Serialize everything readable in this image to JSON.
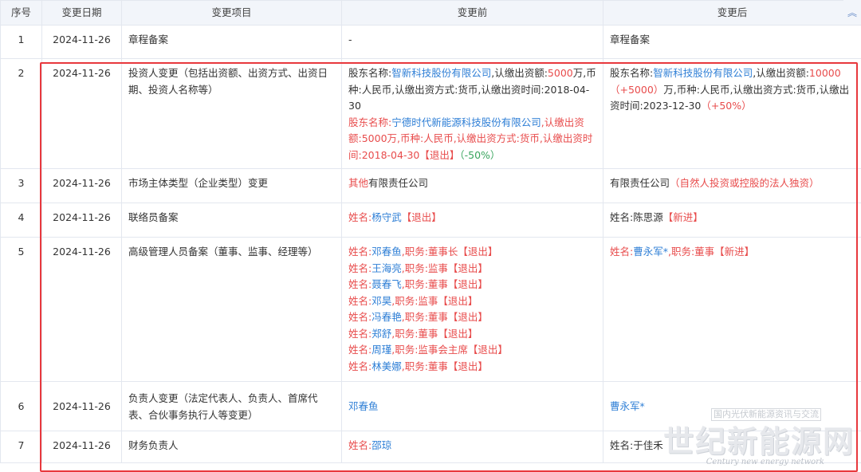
{
  "headers": [
    "序号",
    "变更日期",
    "变更项目",
    "变更前",
    "变更后"
  ],
  "rows": [
    {
      "no": "1",
      "date": "2024-11-26",
      "item": "章程备案",
      "before": [
        [
          {
            "t": "-",
            "c": ""
          }
        ]
      ],
      "after": [
        [
          {
            "t": "章程备案",
            "c": ""
          }
        ]
      ]
    },
    {
      "no": "2",
      "date": "2024-11-26",
      "item": "投资人变更（包括出资额、出资方式、出资日期、投资人名称等）",
      "before": [
        [
          {
            "t": "股东名称:",
            "c": ""
          },
          {
            "t": "智新科技股份有限公司",
            "c": "blue"
          },
          {
            "t": ",认缴出资额:",
            "c": ""
          },
          {
            "t": "5000",
            "c": "red"
          },
          {
            "t": "万,币种:人民币,认缴出资方式:货币,认缴出资时间:2018-04-30",
            "c": ""
          }
        ],
        [
          {
            "t": "股东名称:",
            "c": "red"
          },
          {
            "t": "宁德时代新能源科技股份有限公司",
            "c": "blue"
          },
          {
            "t": ",认缴出资额:5000万,币种:人民币,认缴出资方式:货币,认缴出资时间:2018-04-30【退出】",
            "c": "red"
          },
          {
            "t": "（-50%）",
            "c": "green"
          }
        ]
      ],
      "after": [
        [
          {
            "t": "股东名称:",
            "c": ""
          },
          {
            "t": "智新科技股份有限公司",
            "c": "blue"
          },
          {
            "t": ",认缴出资额:",
            "c": ""
          },
          {
            "t": "10000（+5000）",
            "c": "red"
          },
          {
            "t": "万,币种:人民币,认缴出资方式:货币,认缴出资时间:2023-12-30",
            "c": ""
          },
          {
            "t": "（+50%）",
            "c": "red"
          }
        ]
      ]
    },
    {
      "no": "3",
      "date": "2024-11-26",
      "item": "市场主体类型（企业类型）变更",
      "before": [
        [
          {
            "t": "其他",
            "c": "red"
          },
          {
            "t": "有限责任公司",
            "c": ""
          }
        ]
      ],
      "after": [
        [
          {
            "t": "有限责任公司",
            "c": ""
          },
          {
            "t": "（自然人投资或控股的法人独资）",
            "c": "red"
          }
        ]
      ]
    },
    {
      "no": "4",
      "date": "2024-11-26",
      "item": "联络员备案",
      "before": [
        [
          {
            "t": "姓名:",
            "c": "red"
          },
          {
            "t": "杨守武",
            "c": "blue"
          },
          {
            "t": "【退出】",
            "c": "red"
          }
        ]
      ],
      "after": [
        [
          {
            "t": "姓名:陈思源",
            "c": ""
          },
          {
            "t": "【新进】",
            "c": "red"
          }
        ]
      ]
    },
    {
      "no": "5",
      "date": "2024-11-26",
      "item": "高级管理人员备案（董事、监事、经理等）",
      "before": [
        [
          {
            "t": "姓名:",
            "c": "red"
          },
          {
            "t": "邓春鱼",
            "c": "blue"
          },
          {
            "t": ",职务:董事长【退出】",
            "c": "red"
          }
        ],
        [
          {
            "t": "姓名:",
            "c": "red"
          },
          {
            "t": "王海亮",
            "c": "blue"
          },
          {
            "t": ",职务:监事【退出】",
            "c": "red"
          }
        ],
        [
          {
            "t": "姓名:",
            "c": "red"
          },
          {
            "t": "聂春飞",
            "c": "blue"
          },
          {
            "t": ",职务:董事【退出】",
            "c": "red"
          }
        ],
        [
          {
            "t": "姓名:",
            "c": "red"
          },
          {
            "t": "邓昊",
            "c": "blue"
          },
          {
            "t": ",职务:监事【退出】",
            "c": "red"
          }
        ],
        [
          {
            "t": "姓名:",
            "c": "red"
          },
          {
            "t": "冯春艳",
            "c": "blue"
          },
          {
            "t": ",职务:董事【退出】",
            "c": "red"
          }
        ],
        [
          {
            "t": "姓名:",
            "c": "red"
          },
          {
            "t": "郑舒",
            "c": "blue"
          },
          {
            "t": ",职务:董事【退出】",
            "c": "red"
          }
        ],
        [
          {
            "t": "姓名:",
            "c": "red"
          },
          {
            "t": "周瑾",
            "c": "blue"
          },
          {
            "t": ",职务:监事会主席【退出】",
            "c": "red"
          }
        ],
        [
          {
            "t": "姓名:",
            "c": "red"
          },
          {
            "t": "林美娜",
            "c": "blue"
          },
          {
            "t": ",职务:董事【退出】",
            "c": "red"
          }
        ]
      ],
      "after": [
        [
          {
            "t": "姓名:",
            "c": "red"
          },
          {
            "t": "曹永军*",
            "c": "blue"
          },
          {
            "t": ",职务:董事【新进】",
            "c": "red"
          }
        ]
      ]
    },
    {
      "no": "6",
      "date": "2024-11-26",
      "item": "负责人变更（法定代表人、负责人、首席代表、合伙事务执行人等变更）",
      "before": [
        [
          {
            "t": "邓春鱼",
            "c": "blue"
          }
        ]
      ],
      "after": [
        [
          {
            "t": "曹永军*",
            "c": "blue"
          }
        ]
      ]
    },
    {
      "no": "7",
      "date": "2024-11-26",
      "item": "财务负责人",
      "before": [
        [
          {
            "t": "姓名:",
            "c": "red"
          },
          {
            "t": "邵琼",
            "c": "blue"
          }
        ]
      ],
      "after": [
        [
          {
            "t": "姓名:于佳禾",
            "c": ""
          }
        ]
      ]
    }
  ],
  "scroll_glyph": "︽",
  "watermark": {
    "tagline": "国内光伏新能源资讯与交流",
    "logo_text": "世纪新能源网",
    "english": "Century new energy network"
  },
  "colors": {
    "header_bg": "#f2f5fa",
    "border": "#e3e7ef",
    "red": "#e84c4c",
    "green": "#3aa55e",
    "blue": "#2f7fd6",
    "highlight": "#e8383d"
  }
}
